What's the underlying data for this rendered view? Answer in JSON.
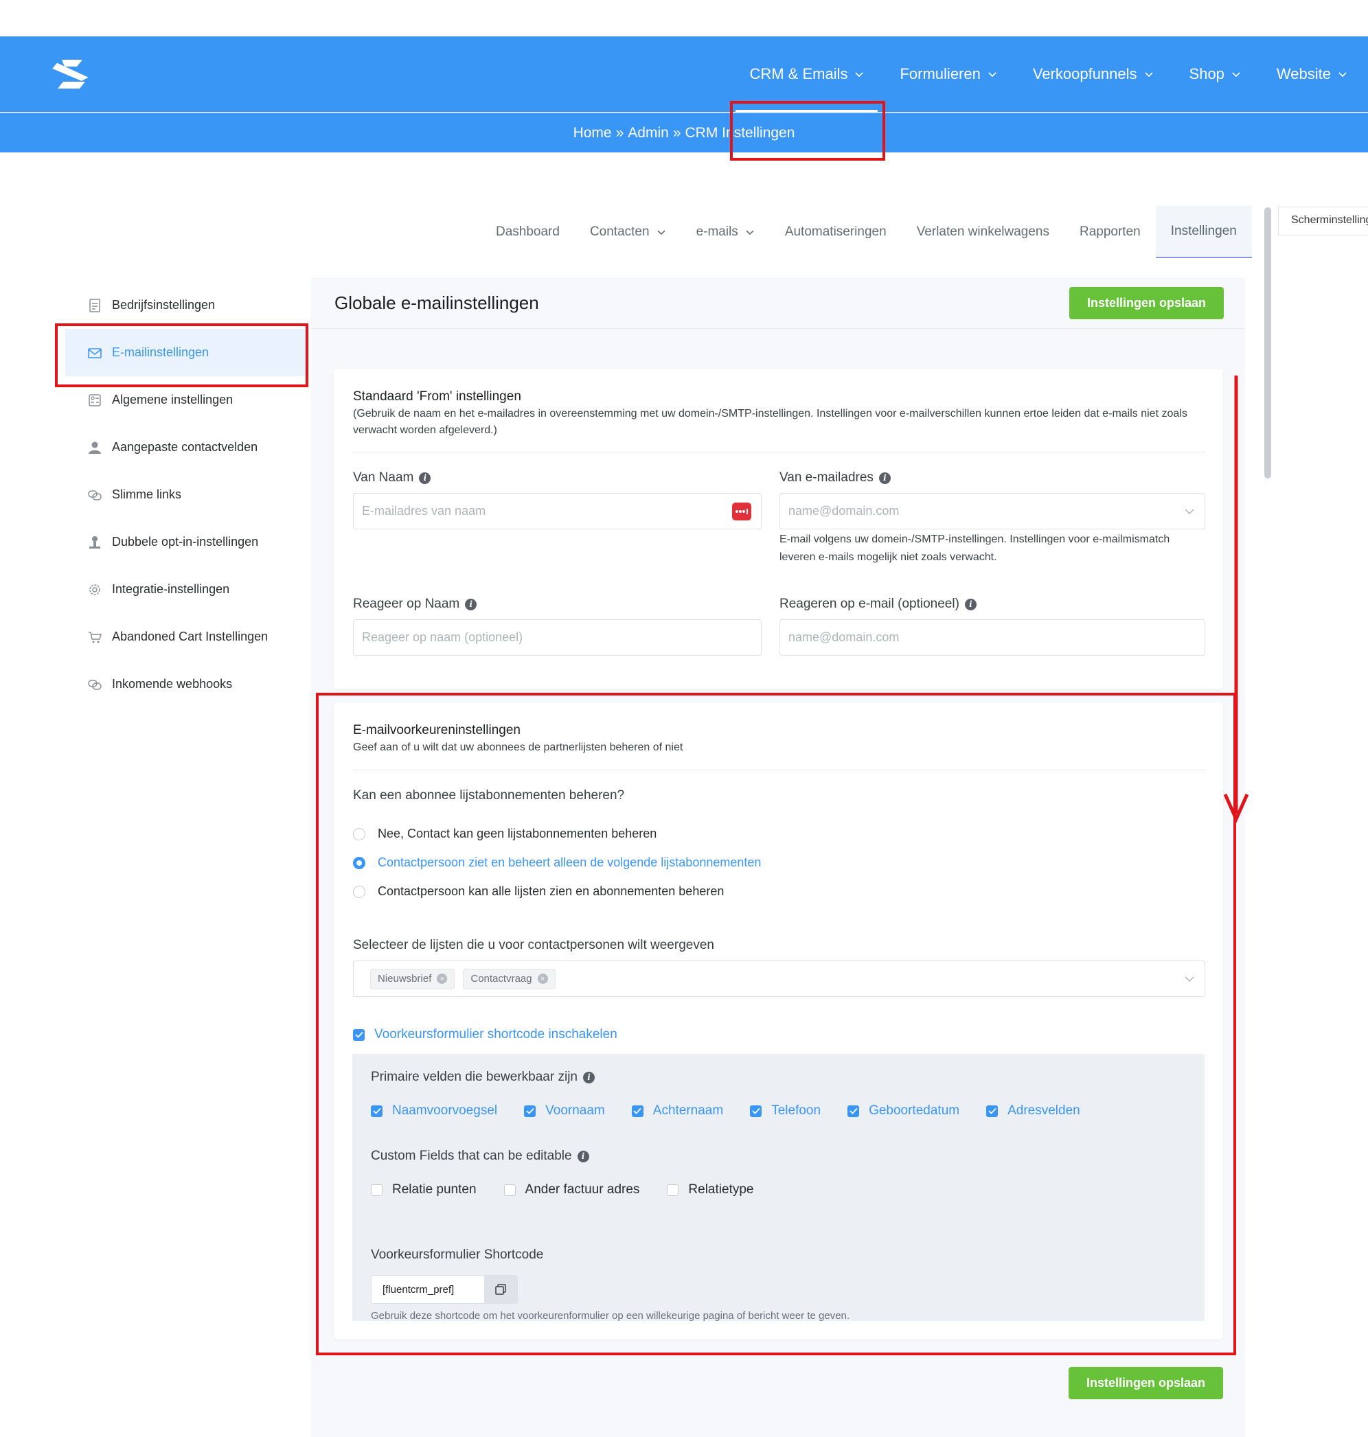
{
  "header": {
    "nav": [
      {
        "label": "CRM & Emails"
      },
      {
        "label": "Formulieren"
      },
      {
        "label": "Verkoopfunnels"
      },
      {
        "label": "Shop"
      },
      {
        "label": "Website"
      }
    ],
    "breadcrumb": {
      "home": "Home",
      "sep1": "»",
      "admin": "Admin",
      "sep2": "»",
      "current": "CRM Instellingen"
    }
  },
  "subtabs": [
    {
      "label": "Dashboard"
    },
    {
      "label": "Contacten"
    },
    {
      "label": "e-mails"
    },
    {
      "label": "Automatiseringen"
    },
    {
      "label": "Verlaten winkelwagens"
    },
    {
      "label": "Rapporten"
    },
    {
      "label": "Instellingen"
    }
  ],
  "screen_options": "Scherminstellingen",
  "sidebar": {
    "items": [
      {
        "label": "Bedrijfsinstellingen"
      },
      {
        "label": "E-mailinstellingen"
      },
      {
        "label": "Algemene instellingen"
      },
      {
        "label": "Aangepaste contactvelden"
      },
      {
        "label": "Slimme links"
      },
      {
        "label": "Dubbele opt-in-instellingen"
      },
      {
        "label": "Integratie-instellingen"
      },
      {
        "label": "Abandoned Cart Instellingen"
      },
      {
        "label": "Inkomende webhooks"
      }
    ]
  },
  "main": {
    "title": "Globale e-mailinstellingen",
    "save_label": "Instellingen opslaan",
    "from_card": {
      "title": "Standaard 'From' instellingen",
      "subtitle": "(Gebruik de naam en het e-mailadres in overeenstemming met uw domein-/SMTP-instellingen. Instellingen voor e-mailverschillen kunnen ertoe leiden dat e-mails niet zoals verwacht worden afgeleverd.)",
      "from_name_label": "Van Naam",
      "from_name_placeholder": "E-mailadres van naam",
      "from_email_label": "Van e-mailadres",
      "from_email_placeholder": "name@domain.com",
      "from_email_help": "E-mail volgens uw domein-/SMTP-instellingen. Instellingen voor e-mailmismatch leveren e-mails mogelijk niet zoals verwacht.",
      "reply_name_label": "Reageer op Naam",
      "reply_name_placeholder": "Reageer op naam (optioneel)",
      "reply_email_label": "Reageren op e-mail (optioneel)",
      "reply_email_placeholder": "name@domain.com"
    },
    "pref_card": {
      "title": "E-mailvoorkeureninstellingen",
      "subtitle": "Geef aan of u wilt dat uw abonnees de partnerlijsten beheren of niet",
      "question": "Kan een abonnee lijstabonnementen beheren?",
      "options": [
        {
          "label": "Nee, Contact kan geen lijstabonnementen beheren",
          "selected": false
        },
        {
          "label": "Contactpersoon ziet en beheert alleen de volgende lijstabonnementen",
          "selected": true
        },
        {
          "label": "Contactpersoon kan alle lijsten zien en abonnementen beheren",
          "selected": false
        }
      ],
      "lists_label": "Selecteer de lijsten die u voor contactpersonen wilt weergeven",
      "lists_selected": [
        "Nieuwsbrief",
        "Contactvraag"
      ],
      "shortcode_enable_label": "Voorkeursformulier shortcode inschakelen",
      "primary_label": "Primaire velden die bewerkbaar zijn",
      "primary_fields": [
        "Naamvoorvoegsel",
        "Voornaam",
        "Achternaam",
        "Telefoon",
        "Geboortedatum",
        "Adresvelden"
      ],
      "custom_label": "Custom Fields that can be editable",
      "custom_fields": [
        "Relatie punten",
        "Ander factuur adres",
        "Relatietype"
      ],
      "shortcode_label": "Voorkeursformulier Shortcode",
      "shortcode_value": "[fluentcrm_pref]",
      "shortcode_help": "Gebruik deze shortcode om het voorkeurenformulier op een willekeurige pagina of bericht weer te geven."
    }
  },
  "colors": {
    "brand_blue": "#3a96f4",
    "save_green": "#67c23a",
    "annotation_red": "#e0141b"
  }
}
